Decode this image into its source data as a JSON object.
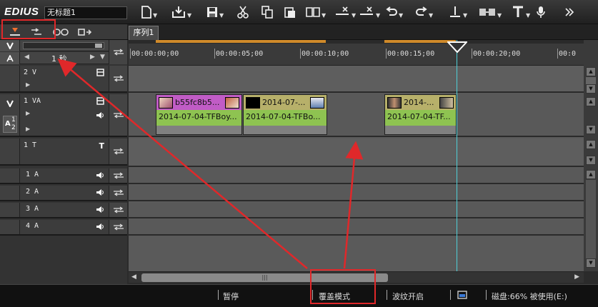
{
  "app": {
    "logo": "EDIUS",
    "project_name": "无标题1"
  },
  "sequence_tab": "序列1",
  "left_controls": {
    "scale_label": "1 秒"
  },
  "ruler": {
    "timecodes": [
      "00:00:00;00",
      "00:00:05;00",
      "00:00:10;00",
      "00:00:15;00",
      "00:00:20;00",
      "00:0"
    ]
  },
  "tracks": [
    {
      "name": "2 V"
    },
    {
      "name": "1 VA",
      "a_channel": "A",
      "a_channel_sub": "1",
      "a_channel_sub2": "2"
    },
    {
      "name": "1 T",
      "type_icon": "T"
    },
    {
      "name": "1 A"
    },
    {
      "name": "2 A"
    },
    {
      "name": "3 A"
    },
    {
      "name": "4 A"
    }
  ],
  "clips": [
    {
      "top_label": "b55fc8b5...",
      "bottom_label": "2014-07-04-TFBoy...",
      "top_color": "#c15cc6"
    },
    {
      "top_label": "2014-07-...",
      "bottom_label": "2014-07-04-TFBo...",
      "top_color": "#b7b06a"
    },
    {
      "top_label": "2014-...",
      "bottom_label": "2014-07-04-TF...",
      "top_color": "#b7b06a"
    }
  ],
  "status": {
    "pause": "暂停",
    "overwrite_mode": "覆盖模式",
    "ripple_on": "波纹开启",
    "disk": "磁盘:66% 被使用(E:)"
  },
  "colors": {
    "annotation": "#e0282a",
    "playhead": "#4fd0d8",
    "audio_bar": "#8ec351"
  }
}
